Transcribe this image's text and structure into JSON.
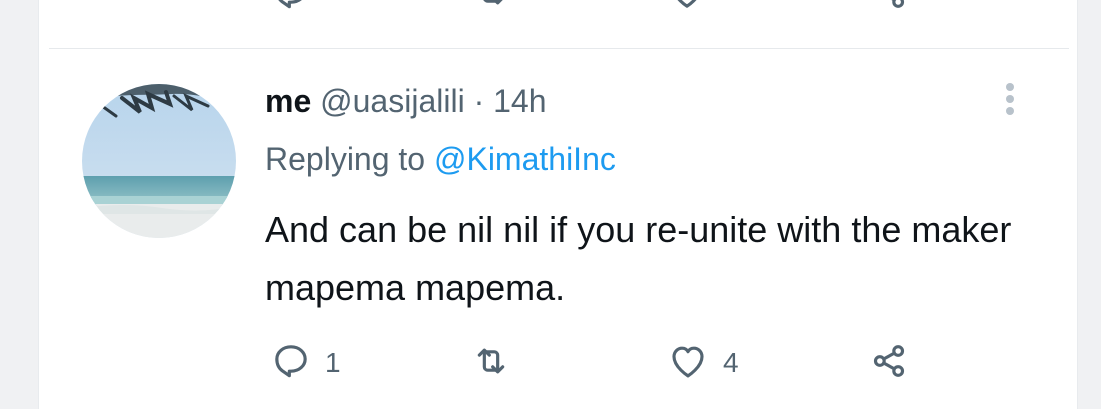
{
  "tweet": {
    "display_name": "me",
    "handle": "@uasijalili",
    "separator": "·",
    "time": "14h",
    "replying_prefix": "Replying to",
    "replying_to": "@KimathiInc",
    "text": "And can be nil nil if you re-unite with the maker mapema mapema.",
    "avatar": "beach-photo",
    "actions": {
      "reply": {
        "icon": "reply-icon",
        "count": "1"
      },
      "retweet": {
        "icon": "retweet-icon",
        "count": ""
      },
      "like": {
        "icon": "heart-icon",
        "count": "4"
      },
      "share": {
        "icon": "share-icon"
      }
    }
  },
  "colors": {
    "text_primary": "#0f1419",
    "text_secondary": "#536471",
    "link": "#1d9bf0",
    "divider": "#e6e9ec",
    "page_background": "#f0f1f3"
  }
}
